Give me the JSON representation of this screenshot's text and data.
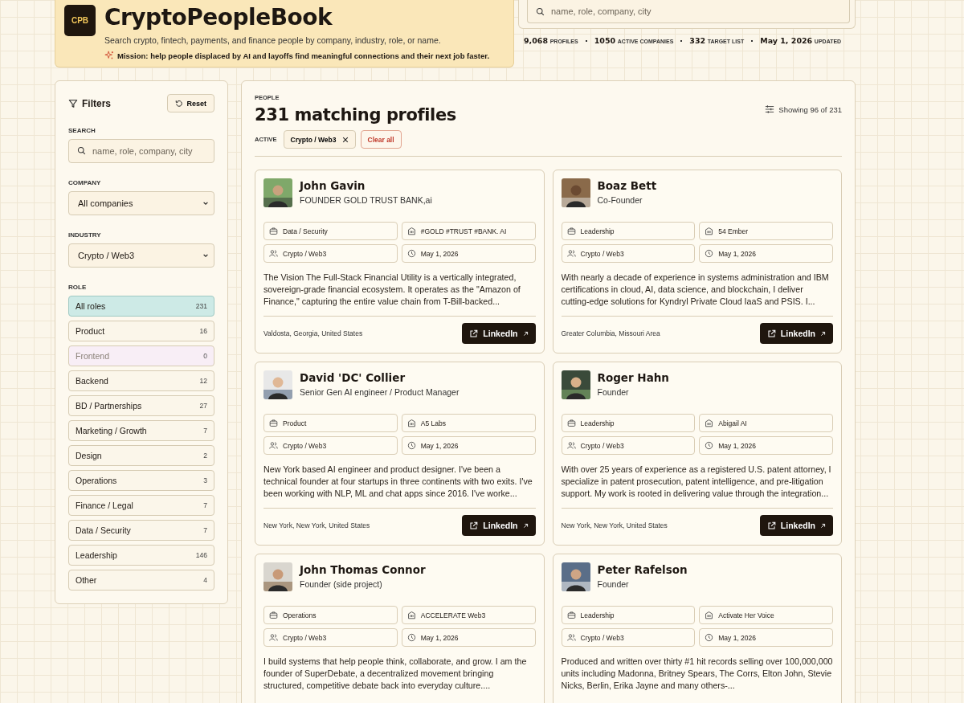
{
  "header": {
    "logo": "CPB",
    "title": "CryptoPeopleBook",
    "subtitle": "Search crypto, fintech, payments, and finance people by company, industry, role, or name.",
    "mission": "Mission: help people displaced by AI and layoffs find meaningful connections and their next job faster."
  },
  "search": {
    "placeholder": "name, role, company, city"
  },
  "stats": [
    {
      "value": "9,068",
      "label": "PROFILES"
    },
    {
      "value": "1050",
      "label": "ACTIVE COMPANIES"
    },
    {
      "value": "332",
      "label": "TARGET LIST"
    },
    {
      "value": "May 1, 2026",
      "label": "UPDATED"
    }
  ],
  "filters": {
    "title": "Filters",
    "reset": "Reset",
    "search": {
      "label": "SEARCH",
      "placeholder": "name, role, company, city"
    },
    "company": {
      "label": "COMPANY",
      "value": "All companies"
    },
    "industry": {
      "label": "INDUSTRY",
      "value": "Crypto / Web3"
    },
    "role": {
      "label": "ROLE",
      "items": [
        {
          "label": "All roles",
          "count": "231",
          "selected": true,
          "disabled": false
        },
        {
          "label": "Product",
          "count": "16",
          "selected": false,
          "disabled": false
        },
        {
          "label": "Frontend",
          "count": "0",
          "selected": false,
          "disabled": true
        },
        {
          "label": "Backend",
          "count": "12",
          "selected": false,
          "disabled": false
        },
        {
          "label": "BD / Partnerships",
          "count": "27",
          "selected": false,
          "disabled": false
        },
        {
          "label": "Marketing / Growth",
          "count": "7",
          "selected": false,
          "disabled": false
        },
        {
          "label": "Design",
          "count": "2",
          "selected": false,
          "disabled": false
        },
        {
          "label": "Operations",
          "count": "3",
          "selected": false,
          "disabled": false
        },
        {
          "label": "Finance / Legal",
          "count": "7",
          "selected": false,
          "disabled": false
        },
        {
          "label": "Data / Security",
          "count": "7",
          "selected": false,
          "disabled": false
        },
        {
          "label": "Leadership",
          "count": "146",
          "selected": false,
          "disabled": false
        },
        {
          "label": "Other",
          "count": "4",
          "selected": false,
          "disabled": false
        }
      ]
    }
  },
  "people": {
    "eyebrow": "PEOPLE",
    "title": "231 matching profiles",
    "showing": "Showing 96 of 231",
    "active_label": "ACTIVE",
    "active_chips": [
      {
        "label": "Crypto / Web3"
      }
    ],
    "clear": "Clear all",
    "cards": [
      {
        "name": "John Gavin",
        "title": "FOUNDER GOLD TRUST BANK,ai",
        "role": "Data / Security",
        "company": "#GOLD #TRUST #BANK. AI",
        "industry": "Crypto / Web3",
        "date": "May 1, 2026",
        "bio": "The Vision The Full-Stack Financial Utility is a vertically integrated, sovereign-grade financial ecosystem. It operates as the \"Amazon of Finance,\" capturing the entire value chain from T-Bill-backed...",
        "location": "Valdosta, Georgia, United States",
        "link": "LinkedIn"
      },
      {
        "name": "Boaz Bett",
        "title": "Co-Founder",
        "role": "Leadership",
        "company": "54 Ember",
        "industry": "Crypto / Web3",
        "date": "May 1, 2026",
        "bio": "With nearly a decade of experience in systems administration and IBM certifications in cloud, AI, data science, and blockchain, I deliver cutting-edge solutions for Kyndryl Private Cloud IaaS and PSIS. I...",
        "location": "Greater Columbia, Missouri Area",
        "link": "LinkedIn"
      },
      {
        "name": "David 'DC' Collier",
        "title": "Senior Gen AI engineer / Product Manager",
        "role": "Product",
        "company": "A5 Labs",
        "industry": "Crypto / Web3",
        "date": "May 1, 2026",
        "bio": "New York based AI engineer and product designer. I've been a technical founder at four startups in three continents with two exits. I've been working with NLP, ML and chat apps since 2016. I've worke...",
        "location": "New York, New York, United States",
        "link": "LinkedIn"
      },
      {
        "name": "Roger Hahn",
        "title": "Founder",
        "role": "Leadership",
        "company": "Abigail AI",
        "industry": "Crypto / Web3",
        "date": "May 1, 2026",
        "bio": "With over 25 years of experience as a registered U.S. patent attorney, I specialize in patent prosecution, patent intelligence, and pre-litigation support. My work is rooted in delivering value through the integration...",
        "location": "New York, New York, United States",
        "link": "LinkedIn"
      },
      {
        "name": "John Thomas Connor",
        "title": "Founder (side project)",
        "role": "Operations",
        "company": "ACCELERATE Web3",
        "industry": "Crypto / Web3",
        "date": "May 1, 2026",
        "bio": "I build systems that help people think, collaborate, and grow. I am the founder of SuperDebate, a decentralized movement bringing structured, competitive debate back into everyday culture...."
      },
      {
        "name": "Peter Rafelson",
        "title": "Founder",
        "role": "Leadership",
        "company": "Activate Her Voice",
        "industry": "Crypto / Web3",
        "date": "May 1, 2026",
        "bio": "Produced and written over thirty #1 hit records selling over 100,000,000 units including Madonna, Britney Spears, The Corrs, Elton John, Stevie Nicks, Berlin, Erika Jayne and many others-..."
      }
    ]
  }
}
